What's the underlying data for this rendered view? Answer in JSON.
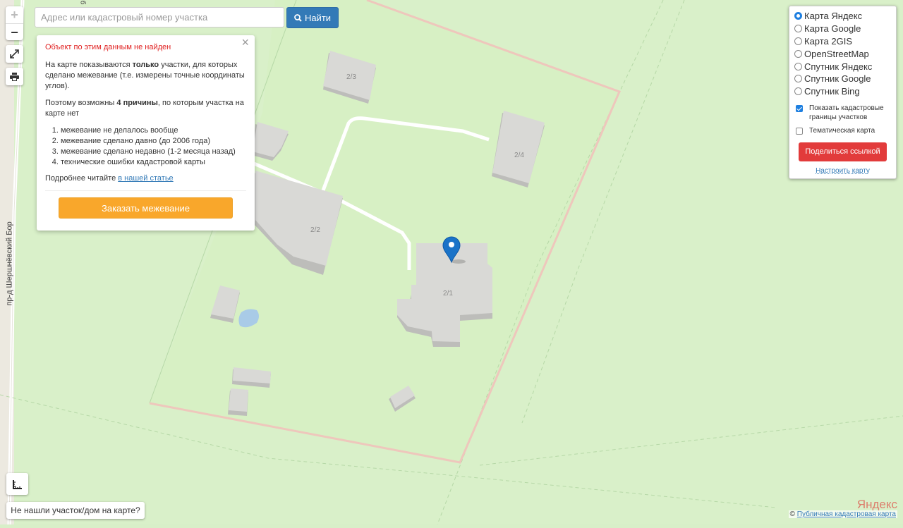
{
  "search": {
    "placeholder": "Адрес или кадастровый номер участка",
    "button_label": "Найти"
  },
  "zoom": {
    "in_label": "+",
    "out_label": "−"
  },
  "popup": {
    "error": "Объект по этим данным не найден",
    "para1_a": "На карте показываются ",
    "para1_bold": "только",
    "para1_b": " участки, для которых сделано межевание (т.е. измерены точные координаты углов).",
    "para2_a": "Поэтому возможны ",
    "para2_bold": "4 причины",
    "para2_b": ", по которым участка на карте нет",
    "reasons": [
      "межевание не делалось вообще",
      "межевание сделано давно (до 2006 года)",
      "межевание сделано недавно (1-2 месяца назад)",
      "технические ошибки кадастровой карты"
    ],
    "more_text": "Подробнее читайте ",
    "more_link": "в нашей статье",
    "order_button": "Заказать межевание",
    "close_symbol": "×"
  },
  "layers": {
    "options": [
      {
        "label": "Карта Яндекс",
        "selected": true
      },
      {
        "label": "Карта Google",
        "selected": false
      },
      {
        "label": "Карта 2GIS",
        "selected": false
      },
      {
        "label": "OpenStreetMap",
        "selected": false
      },
      {
        "label": "Спутник Яндекс",
        "selected": false
      },
      {
        "label": "Спутник Google",
        "selected": false
      },
      {
        "label": "Спутник Bing",
        "selected": false
      }
    ],
    "checkbox_cadastral": "Показать кадастровые границы участков",
    "checkbox_cadastral_checked": true,
    "checkbox_thematic": "Тематическая карта",
    "checkbox_thematic_checked": false,
    "share_button": "Поделиться ссылкой",
    "tune_link": "Настроить карту"
  },
  "map": {
    "plot_labels": [
      "2/3",
      "2/4",
      "2/2",
      "2/1"
    ],
    "street_left": "пр-д Шершнёвский Бор",
    "street_top": "б"
  },
  "not_found_button": "Не нашли участок/дом на карте?",
  "attribution": {
    "prefix": "© ",
    "link": "Публичная кадастровая карта",
    "logo": "Яндекс"
  },
  "icons": {
    "search": "search-icon",
    "fullscreen": "expand-icon",
    "print": "printer-icon",
    "ruler": "ruler-icon",
    "marker": "map-marker-icon",
    "close": "close-icon"
  },
  "colors": {
    "map_background": "#d8efc8",
    "building": "#d9d9d6",
    "parcel_border": "#f2c9c0",
    "find_button": "#337ab7",
    "order_button": "#f9a72b",
    "share_button": "#e23b3b",
    "error_text": "#e02020",
    "marker": "#1a73c8"
  }
}
